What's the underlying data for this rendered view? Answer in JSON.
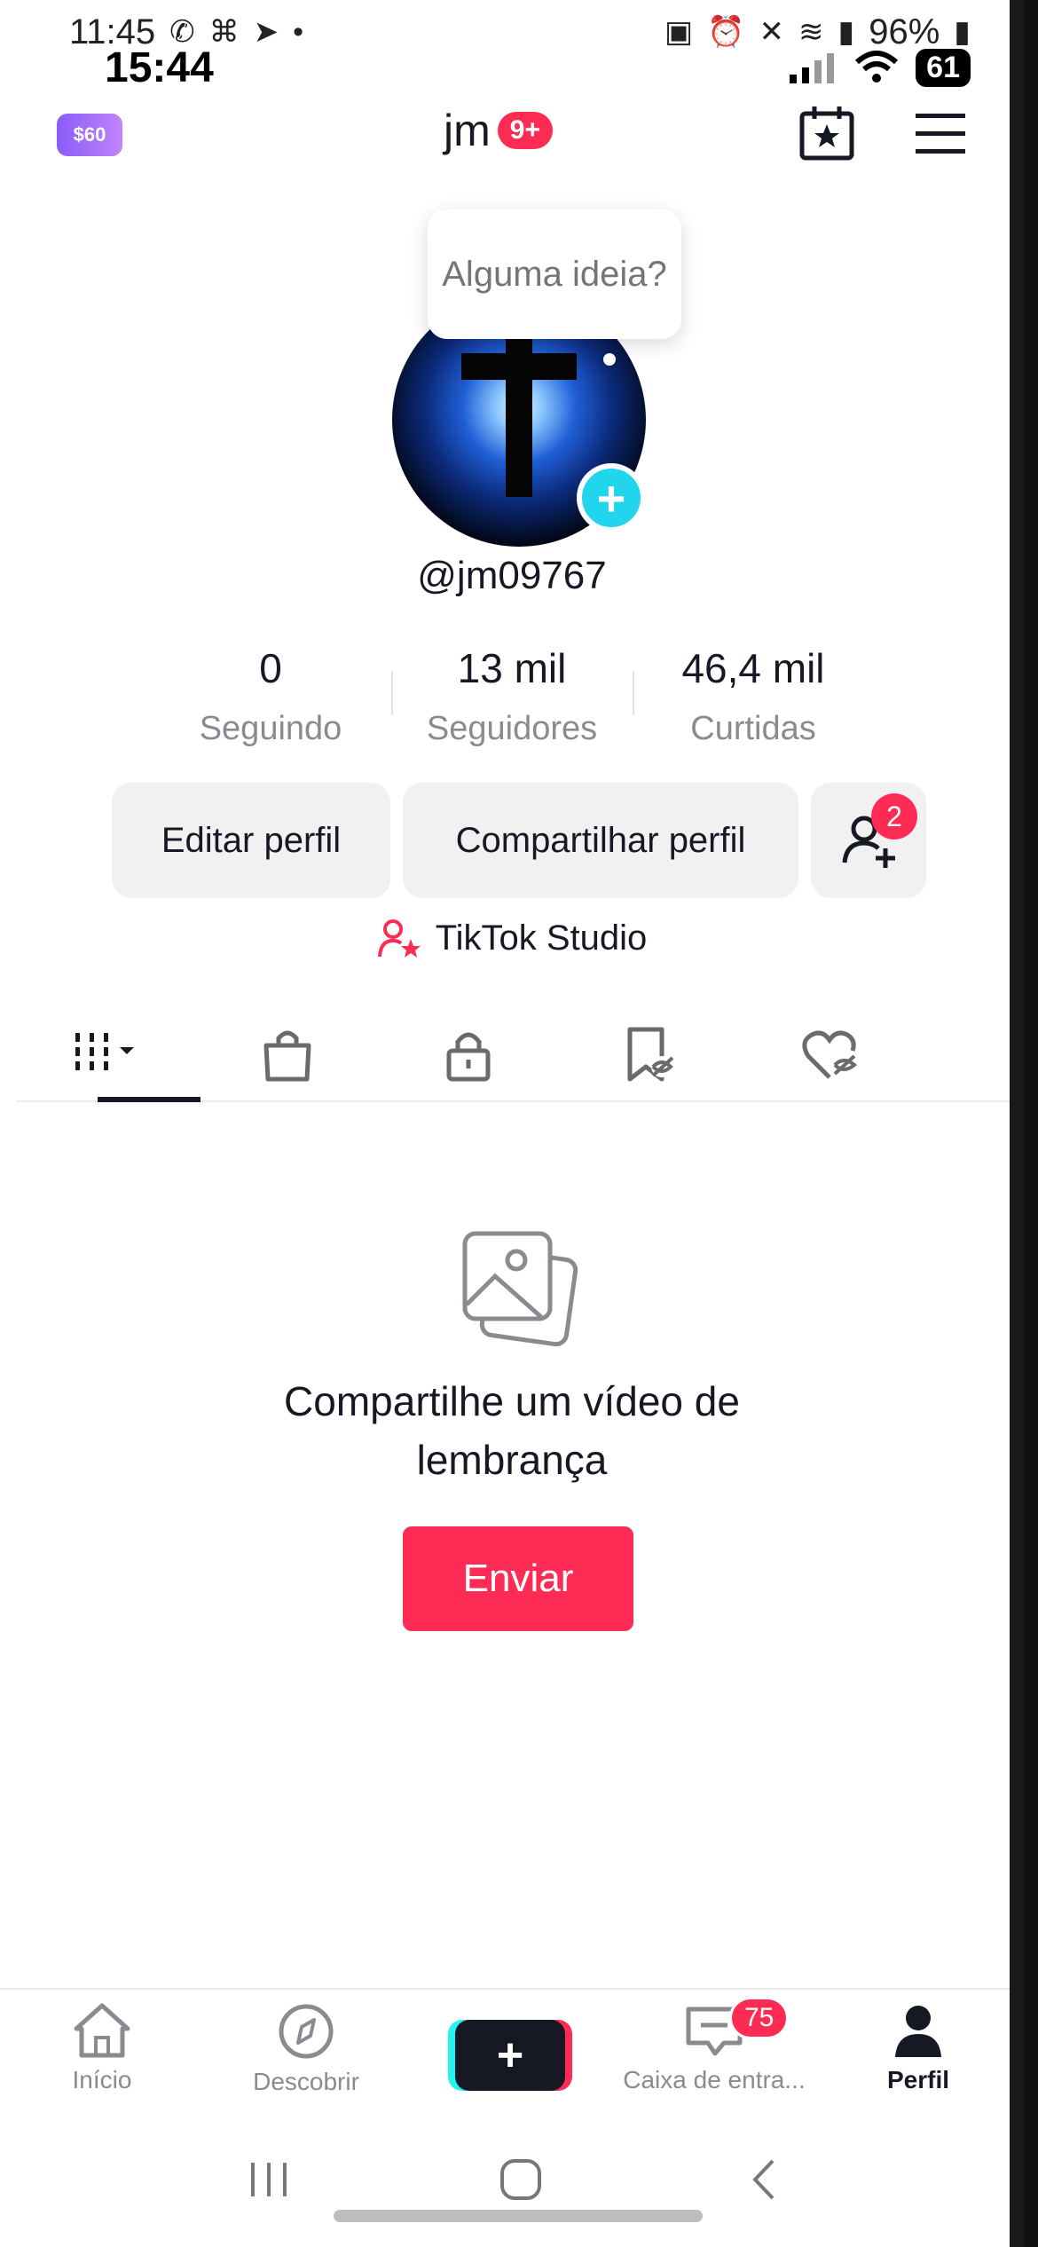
{
  "status_android": {
    "time": "11:45",
    "battery": "96%"
  },
  "status_ios": {
    "time": "15:44",
    "battery": "61"
  },
  "header": {
    "coin_label": "$60",
    "title": "jm",
    "notifications": "9+"
  },
  "profile": {
    "bubble_text": "Alguma ideia?",
    "username": "@jm09767",
    "stats": [
      {
        "value": "0",
        "label": "Seguindo"
      },
      {
        "value": "13 mil",
        "label": "Seguidores"
      },
      {
        "value": "46,4 mil",
        "label": "Curtidas"
      }
    ],
    "buttons": {
      "edit": "Editar perfil",
      "share": "Compartilhar perfil",
      "friends_badge": "2"
    },
    "studio": "TikTok Studio"
  },
  "empty_state": {
    "text": "Compartilhe um vídeo de lembrança",
    "button": "Enviar"
  },
  "bottom_nav": {
    "items": [
      {
        "label": "Início",
        "icon": "home-icon"
      },
      {
        "label": "Descobrir",
        "icon": "compass-icon"
      },
      {
        "label": "",
        "icon": "plus-icon"
      },
      {
        "label": "Caixa de entra...",
        "icon": "inbox-icon",
        "badge": "75"
      },
      {
        "label": "Perfil",
        "icon": "person-icon"
      }
    ]
  },
  "colors": {
    "accent": "#fe2c55",
    "teal": "#20d5ec"
  }
}
